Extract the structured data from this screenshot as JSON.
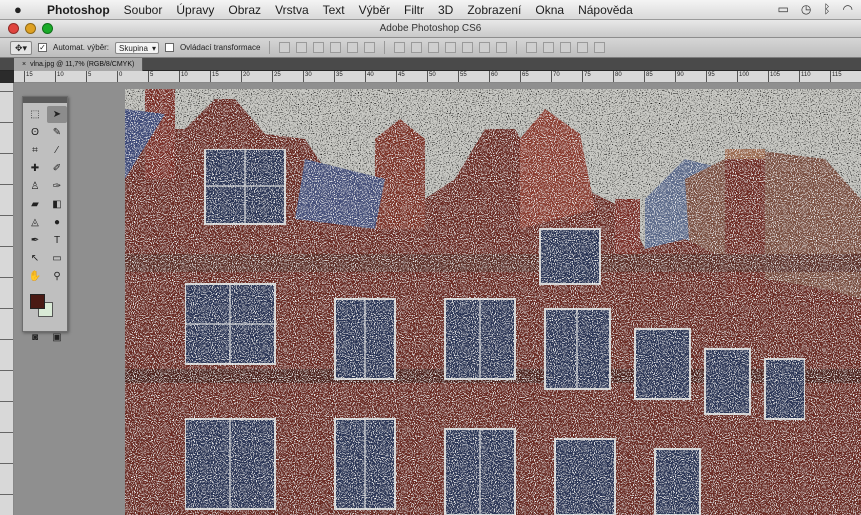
{
  "menubar": {
    "app_name": "Photoshop",
    "items": [
      "Soubor",
      "Úpravy",
      "Obraz",
      "Vrstva",
      "Text",
      "Výběr",
      "Filtr",
      "3D",
      "Zobrazení",
      "Okna",
      "Nápověda"
    ]
  },
  "window": {
    "title": "Adobe Photoshop CS6"
  },
  "options_bar": {
    "auto_select_label": "Automat. výběr:",
    "auto_select_value": "Skupina",
    "transform_label": "Ovládací transformace"
  },
  "document": {
    "tab_label": "vlna.jpg @ 11,7% (RGB/8/CMYK)"
  },
  "ruler": {
    "h_ticks": [
      "15",
      "10",
      "5",
      "0",
      "5",
      "10",
      "15",
      "20",
      "25",
      "30",
      "35",
      "40",
      "45",
      "50",
      "55",
      "60",
      "65",
      "70",
      "75",
      "80",
      "85",
      "90",
      "95",
      "100",
      "105",
      "110",
      "115"
    ]
  },
  "colors": {
    "foreground": "#4a1a14",
    "background": "#d9ead6"
  },
  "tools": [
    "move-tool",
    "marquee-tool",
    "lasso-tool",
    "quick-select-tool",
    "crop-tool",
    "eyedropper-tool",
    "healing-brush-tool",
    "brush-tool",
    "clone-stamp-tool",
    "history-brush-tool",
    "eraser-tool",
    "gradient-tool",
    "blur-tool",
    "dodge-tool",
    "pen-tool",
    "type-tool",
    "path-select-tool",
    "shape-tool",
    "hand-tool",
    "zoom-tool"
  ]
}
